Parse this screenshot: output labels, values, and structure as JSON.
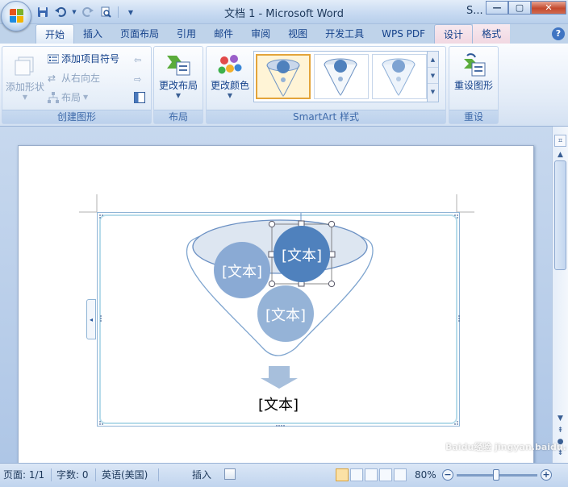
{
  "window": {
    "title": "文档 1 - Microsoft Word",
    "title_fragment": "S...",
    "controls": {
      "minimize": "—",
      "maximize": "▢",
      "close": "✕"
    }
  },
  "quick_access": [
    "save-icon",
    "undo-icon",
    "redo-icon",
    "print-preview-icon",
    "customize-icon"
  ],
  "tabs": [
    {
      "label": "开始",
      "state": "home"
    },
    {
      "label": "插入",
      "state": "normal"
    },
    {
      "label": "页面布局",
      "state": "normal"
    },
    {
      "label": "引用",
      "state": "normal"
    },
    {
      "label": "邮件",
      "state": "normal"
    },
    {
      "label": "审阅",
      "state": "normal"
    },
    {
      "label": "视图",
      "state": "normal"
    },
    {
      "label": "开发工具",
      "state": "normal"
    },
    {
      "label": "WPS PDF",
      "state": "normal"
    },
    {
      "label": "设计",
      "state": "active"
    },
    {
      "label": "格式",
      "state": "normal"
    }
  ],
  "help": "?",
  "ribbon": {
    "create_graphic": {
      "label": "创建图形",
      "add_shape": "添加形状",
      "add_bullet": "添加项目符号",
      "right_to_left": "从右向左",
      "layout": "布局"
    },
    "layouts": {
      "label": "布局",
      "change_layout": "更改布局"
    },
    "styles": {
      "label": "SmartArt 样式",
      "change_colors": "更改颜色"
    },
    "reset": {
      "label": "重设",
      "reset_graphic": "重设图形"
    }
  },
  "document": {
    "funnel_nodes": [
      "[文本]",
      "[文本]",
      "[文本]"
    ],
    "bottom_text": "[文本]",
    "colors": {
      "node_dark": "#4f81bd",
      "node_light": "#95b3d7",
      "funnel_line": "#7fa5cf",
      "frame": "#b7dcea"
    }
  },
  "statusbar": {
    "page": "页面: 1/1",
    "words": "字数: 0",
    "language": "英语(美国)",
    "mode": "插入",
    "zoom": "80%",
    "zoom_out": "−",
    "zoom_in": "+"
  },
  "watermark": "Baidu经验 jingyan.baidu.com"
}
